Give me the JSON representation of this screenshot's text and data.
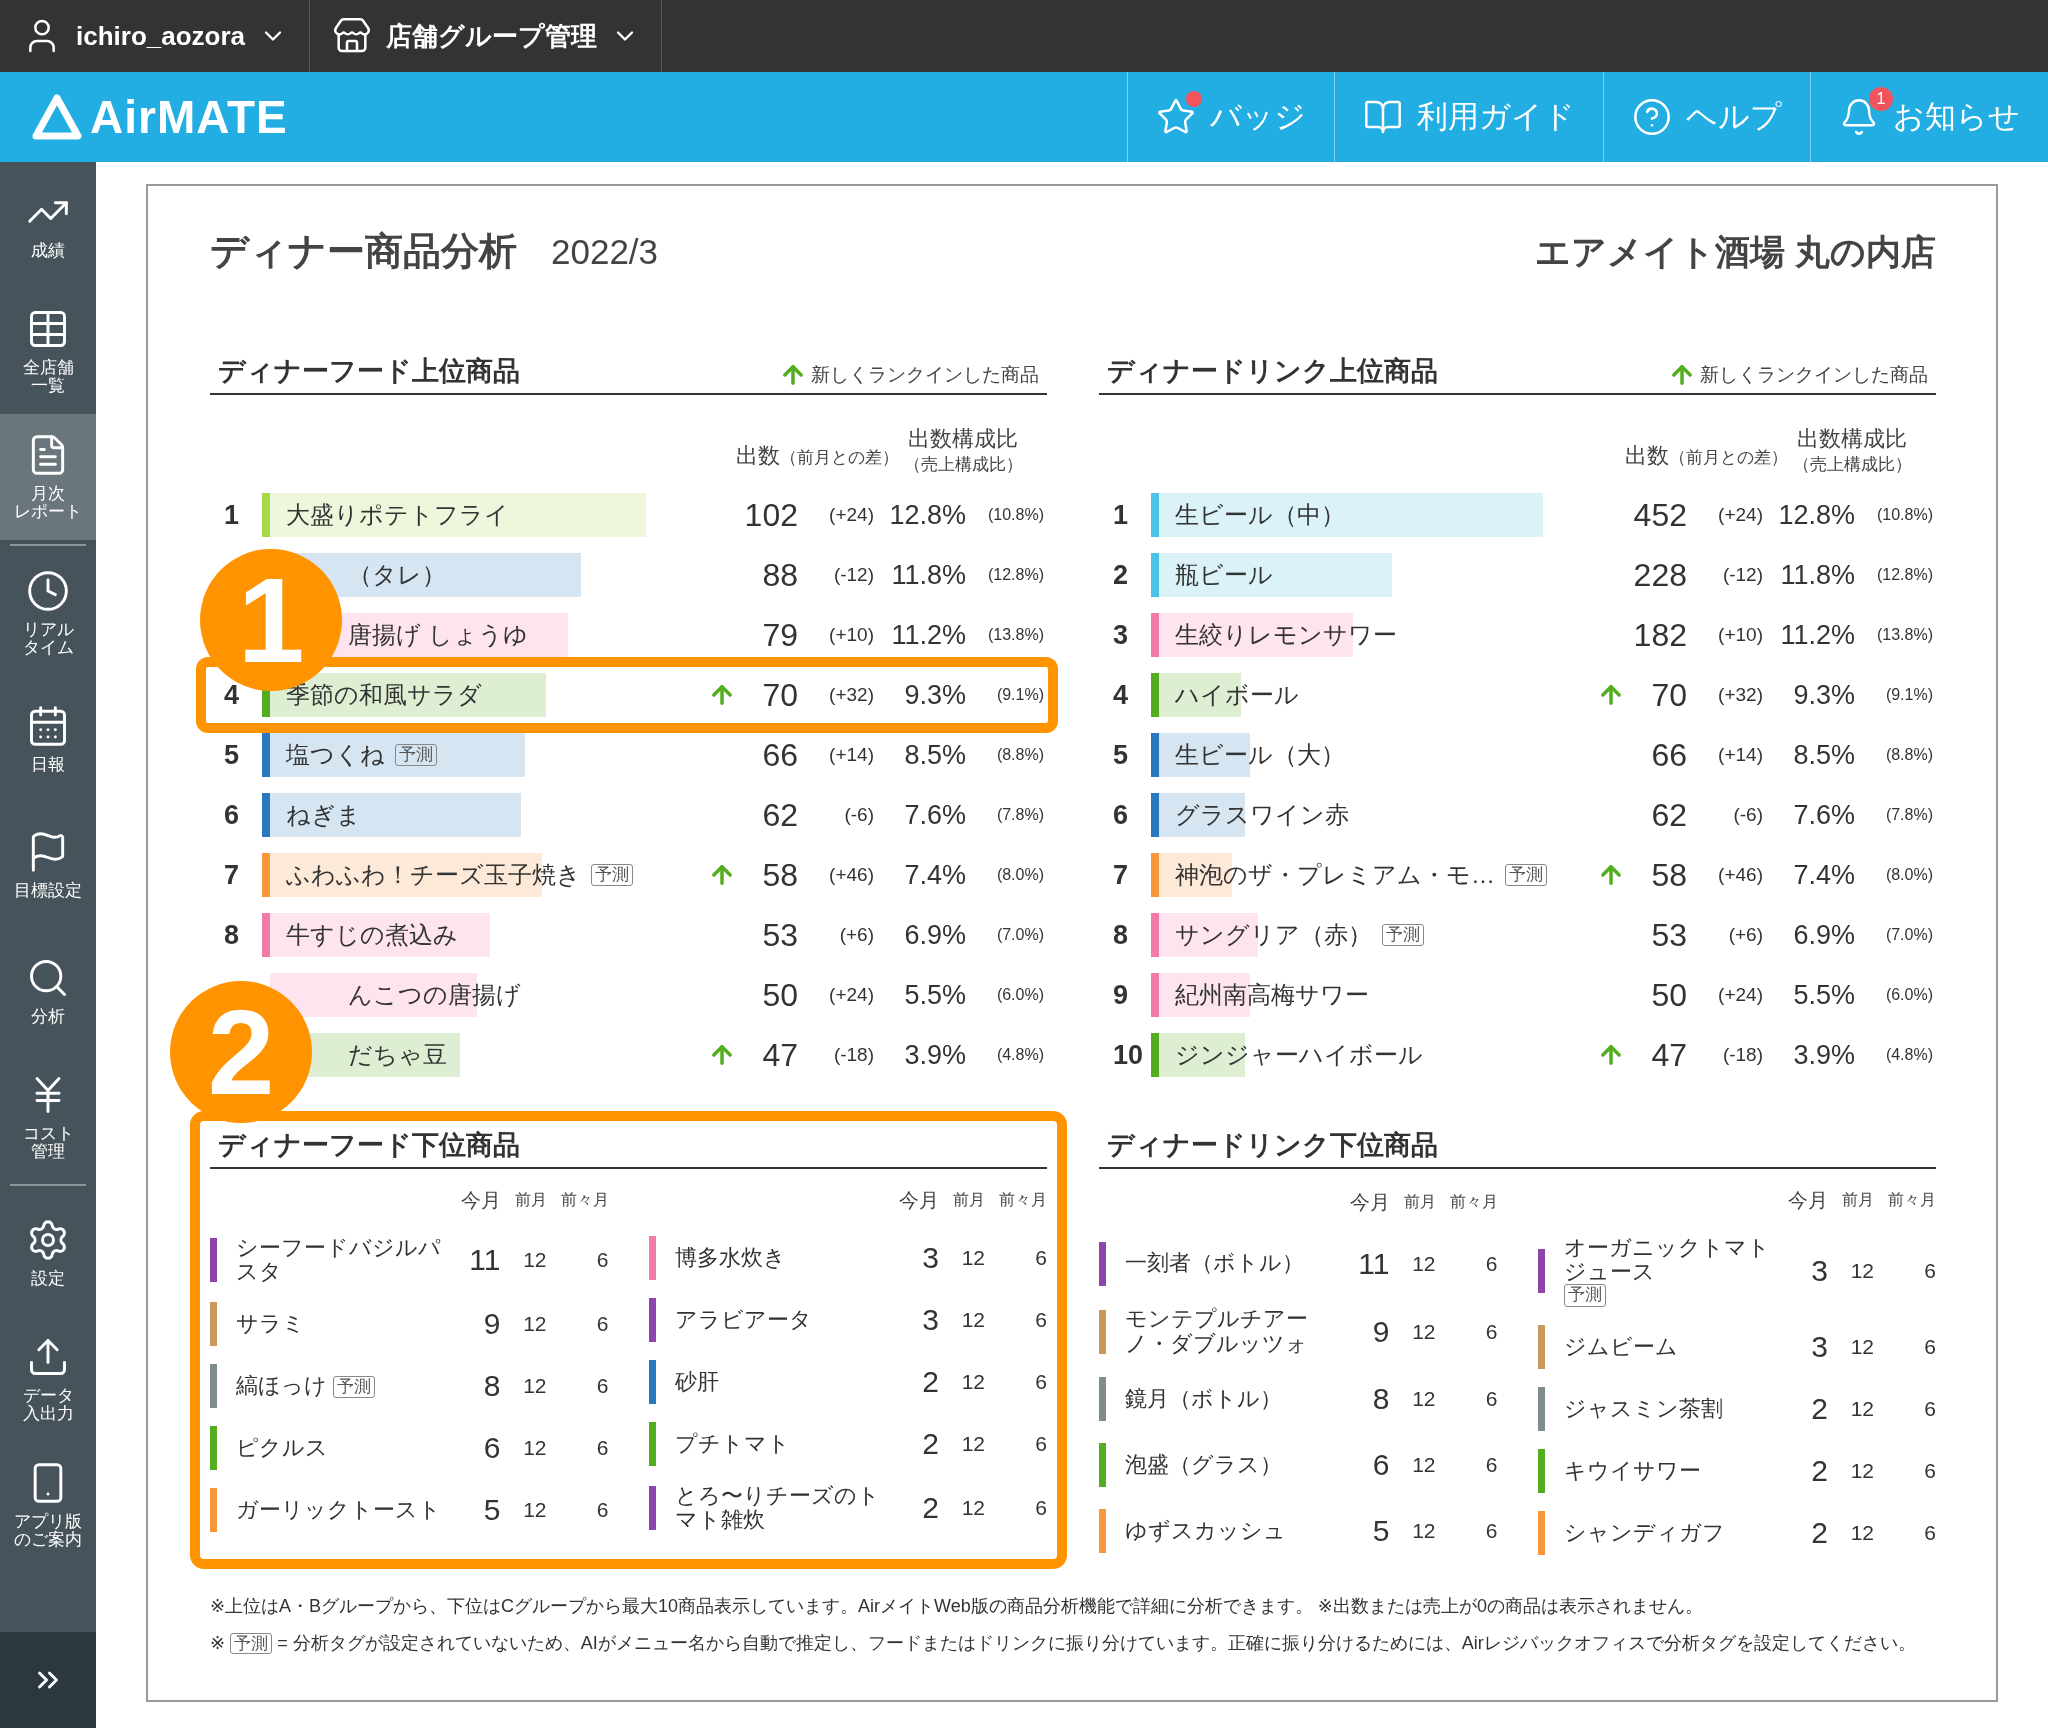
{
  "topbar": {
    "user": "ichiro_aozora",
    "group": "店舗グループ管理"
  },
  "header": {
    "logo": "AirMATE",
    "nav": [
      {
        "label": "バッジ",
        "dot": true
      },
      {
        "label": "利用ガイド",
        "dot": false
      },
      {
        "label": "ヘルプ",
        "dot": false
      },
      {
        "label": "お知らせ",
        "dot": false,
        "badge": "1"
      }
    ]
  },
  "sidebar": {
    "items": [
      {
        "lines": [
          "成績"
        ],
        "selected": false
      },
      {
        "lines": [
          "全店舗",
          "一覧"
        ],
        "selected": false
      },
      {
        "lines": [
          "月次",
          "レポート"
        ],
        "selected": true
      },
      {
        "lines": [
          "リアル",
          "タイム"
        ],
        "selected": false
      },
      {
        "lines": [
          "日報"
        ],
        "selected": false
      },
      {
        "lines": [
          "目標設定"
        ],
        "selected": false
      },
      {
        "lines": [
          "分析"
        ],
        "selected": false
      },
      {
        "lines": [
          "コスト",
          "管理"
        ],
        "selected": false
      },
      {
        "lines": [
          "設定"
        ],
        "selected": false
      },
      {
        "lines": [
          "データ",
          "入出力"
        ],
        "selected": false
      },
      {
        "lines": [
          "アプリ版",
          "のご案内"
        ],
        "selected": false
      }
    ]
  },
  "report": {
    "title": "ディナー商品分析",
    "period": "2022/3",
    "store": "エアメイト酒場 丸の内店",
    "top_sections": [
      {
        "heading": "ディナーフード上位商品",
        "legend": "新しくランクインした商品",
        "col_count": "出数",
        "col_count_sub": "（前月との差）",
        "col_ratio": "出数構成比",
        "col_ratio_sub": "（売上構成比）",
        "callout": "1",
        "rows": [
          {
            "rank": "1",
            "name": "大盛りポテトフライ",
            "color": "#a6d94a",
            "bar": {
              "color": "#eef7dc",
              "level": 0.87
            },
            "new": false,
            "covered": false,
            "highlighted": false,
            "count": "102",
            "diff": "(+24)",
            "ratio": "12.8%",
            "sales_ratio": "(10.8%)"
          },
          {
            "name": "（タレ）",
            "bar": {
              "color": "#d5e5f2",
              "level": 0.72
            },
            "new": false,
            "covered": true,
            "highlighted": false,
            "count": "88",
            "diff": "(-12)",
            "ratio": "11.8%",
            "sales_ratio": "(12.8%)"
          },
          {
            "name": "唐揚げ しょうゆ",
            "bar": {
              "color": "#fde4ee",
              "level": 0.69
            },
            "new": false,
            "covered": true,
            "highlighted": false,
            "count": "79",
            "diff": "(+10)",
            "ratio": "11.2%",
            "sales_ratio": "(13.8%)"
          },
          {
            "rank": "4",
            "name": "季節の和風サラダ",
            "color": "#52ad1f",
            "bar": {
              "color": "#ddeed2",
              "level": 0.64
            },
            "new": true,
            "covered": false,
            "highlighted": true,
            "count": "70",
            "diff": "(+32)",
            "ratio": "9.3%",
            "sales_ratio": "(9.1%)"
          },
          {
            "rank": "5",
            "name": "塩つくね",
            "tag": "予測",
            "color": "#2a78bd",
            "bar": {
              "color": "#d5e5f2",
              "level": 0.59
            },
            "new": false,
            "covered": false,
            "highlighted": false,
            "count": "66",
            "diff": "(+14)",
            "ratio": "8.5%",
            "sales_ratio": "(8.8%)"
          },
          {
            "rank": "6",
            "name": "ねぎま",
            "color": "#2a78bd",
            "bar": {
              "color": "#d5e5f2",
              "level": 0.58
            },
            "new": false,
            "covered": false,
            "highlighted": false,
            "count": "62",
            "diff": "(-6)",
            "ratio": "7.6%",
            "sales_ratio": "(7.8%)"
          },
          {
            "rank": "7",
            "name": "ふわふわ！チーズ玉子焼き",
            "tag": "予測",
            "color": "#f7963a",
            "bar": {
              "color": "#fde9d8",
              "level": 0.63
            },
            "new": true,
            "covered": false,
            "highlighted": false,
            "count": "58",
            "diff": "(+46)",
            "ratio": "7.4%",
            "sales_ratio": "(8.0%)"
          },
          {
            "rank": "8",
            "name": "牛すじの煮込み",
            "color": "#f27aa8",
            "bar": {
              "color": "#fde4ee",
              "level": 0.51
            },
            "new": false,
            "covered": false,
            "highlighted": false,
            "count": "53",
            "diff": "(+6)",
            "ratio": "6.9%",
            "sales_ratio": "(7.0%)"
          },
          {
            "name": "んこつの唐揚げ",
            "bar": {
              "color": "#fde4ee",
              "level": 0.48
            },
            "new": false,
            "covered": true,
            "highlighted": false,
            "count": "50",
            "diff": "(+24)",
            "ratio": "5.5%",
            "sales_ratio": "(6.0%)"
          },
          {
            "name": "だちゃ豆",
            "bar": {
              "color": "#ddeed2",
              "level": 0.44
            },
            "new": true,
            "covered": true,
            "highlighted": false,
            "count": "47",
            "diff": "(-18)",
            "ratio": "3.9%",
            "sales_ratio": "(4.8%)"
          }
        ]
      },
      {
        "heading": "ディナードリンク上位商品",
        "legend": "新しくランクインした商品",
        "col_count": "出数",
        "col_count_sub": "（前月との差）",
        "col_ratio": "出数構成比",
        "col_ratio_sub": "（売上構成比）",
        "rows": [
          {
            "rank": "1",
            "name": "生ビール（中）",
            "color": "#4cc3e6",
            "bar": {
              "color": "#dbf2f9",
              "level": 0.89
            },
            "new": false,
            "covered": false,
            "highlighted": false,
            "count": "452",
            "diff": "(+24)",
            "ratio": "12.8%",
            "sales_ratio": "(10.8%)"
          },
          {
            "rank": "2",
            "name": "瓶ビール",
            "color": "#4cc3e6",
            "bar": {
              "color": "#dbf2f9",
              "level": 0.54
            },
            "new": false,
            "covered": false,
            "highlighted": false,
            "count": "228",
            "diff": "(-12)",
            "ratio": "11.8%",
            "sales_ratio": "(12.8%)"
          },
          {
            "rank": "3",
            "name": "生絞りレモンサワー",
            "color": "#f27aa8",
            "bar": {
              "color": "#fde4ee",
              "level": 0.45
            },
            "new": false,
            "covered": false,
            "highlighted": false,
            "count": "182",
            "diff": "(+10)",
            "ratio": "11.2%",
            "sales_ratio": "(13.8%)"
          },
          {
            "rank": "4",
            "name": "ハイボール",
            "color": "#52ad1f",
            "bar": {
              "color": "#ddeed2",
              "level": 0.19
            },
            "new": true,
            "covered": false,
            "highlighted": false,
            "count": "70",
            "diff": "(+32)",
            "ratio": "9.3%",
            "sales_ratio": "(9.1%)"
          },
          {
            "rank": "5",
            "name": "生ビール（大）",
            "color": "#2a78bd",
            "bar": {
              "color": "#d5e5f2",
              "level": 0.21
            },
            "new": false,
            "covered": false,
            "highlighted": false,
            "count": "66",
            "diff": "(+14)",
            "ratio": "8.5%",
            "sales_ratio": "(8.8%)"
          },
          {
            "rank": "6",
            "name": "グラスワイン赤",
            "color": "#2a78bd",
            "bar": {
              "color": "#d5e5f2",
              "level": 0.2
            },
            "new": false,
            "covered": false,
            "highlighted": false,
            "count": "62",
            "diff": "(-6)",
            "ratio": "7.6%",
            "sales_ratio": "(7.8%)"
          },
          {
            "rank": "7",
            "name": "神泡のザ・プレミアム・モ…",
            "tag": "予測",
            "color": "#f7963a",
            "bar": {
              "color": "#fde9d8",
              "level": 0.17
            },
            "new": true,
            "covered": false,
            "highlighted": false,
            "count": "58",
            "diff": "(+46)",
            "ratio": "7.4%",
            "sales_ratio": "(8.0%)"
          },
          {
            "rank": "8",
            "name": "サングリア（赤）",
            "tag": "予測",
            "color": "#f27aa8",
            "bar": {
              "color": "#fde4ee",
              "level": 0.23
            },
            "new": false,
            "covered": false,
            "highlighted": false,
            "count": "53",
            "diff": "(+6)",
            "ratio": "6.9%",
            "sales_ratio": "(7.0%)"
          },
          {
            "rank": "9",
            "name": "紀州南高梅サワー",
            "color": "#f27aa8",
            "bar": {
              "color": "#fde4ee",
              "level": 0.21
            },
            "new": false,
            "covered": false,
            "highlighted": false,
            "count": "50",
            "diff": "(+24)",
            "ratio": "5.5%",
            "sales_ratio": "(6.0%)"
          },
          {
            "rank": "10",
            "name": "ジンジャーハイボール",
            "color": "#52ad1f",
            "bar": {
              "color": "#ddeed2",
              "level": 0.2
            },
            "new": true,
            "covered": false,
            "highlighted": false,
            "count": "47",
            "diff": "(-18)",
            "ratio": "3.9%",
            "sales_ratio": "(4.8%)"
          }
        ]
      }
    ],
    "bottom_sections": [
      {
        "heading": "ディナーフード下位商品",
        "highlighted": true,
        "callout": "2",
        "columns": [
          {
            "headers": [
              "今月",
              "前月",
              "前々月"
            ],
            "items": [
              {
                "name": "シーフードバジルパスタ",
                "color": "#8e44ad",
                "this_month": "11",
                "last_month": "12",
                "two_months_ago": "6"
              },
              {
                "name": "サラミ",
                "color": "#c9995a",
                "this_month": "9",
                "last_month": "12",
                "two_months_ago": "6"
              },
              {
                "name": "縞ほっけ",
                "tag": "予測",
                "color": "#7f8c8d",
                "this_month": "8",
                "last_month": "12",
                "two_months_ago": "6"
              },
              {
                "name": "ピクルス",
                "color": "#52ad1f",
                "this_month": "6",
                "last_month": "12",
                "two_months_ago": "6"
              },
              {
                "name": "ガーリックトースト",
                "color": "#f7963a",
                "this_month": "5",
                "last_month": "12",
                "two_months_ago": "6"
              }
            ]
          },
          {
            "headers": [
              "今月",
              "前月",
              "前々月"
            ],
            "items": [
              {
                "name": "博多水炊き",
                "color": "#f27aa8",
                "this_month": "3",
                "last_month": "12",
                "two_months_ago": "6"
              },
              {
                "name": "アラビアータ",
                "color": "#8e44ad",
                "this_month": "3",
                "last_month": "12",
                "two_months_ago": "6"
              },
              {
                "name": "砂肝",
                "color": "#2a78bd",
                "this_month": "2",
                "last_month": "12",
                "two_months_ago": "6"
              },
              {
                "name": "プチトマト",
                "color": "#52ad1f",
                "this_month": "2",
                "last_month": "12",
                "two_months_ago": "6"
              },
              {
                "name": "とろ〜りチーズのトマト雑炊",
                "color": "#8e44ad",
                "this_month": "2",
                "last_month": "12",
                "two_months_ago": "6"
              }
            ]
          }
        ]
      },
      {
        "heading": "ディナードリンク下位商品",
        "highlighted": false,
        "columns": [
          {
            "headers": [
              "今月",
              "前月",
              "前々月"
            ],
            "items": [
              {
                "name": "一刻者（ボトル）",
                "color": "#8e44ad",
                "this_month": "11",
                "last_month": "12",
                "two_months_ago": "6"
              },
              {
                "name": "モンテプルチアーノ・ダブルッツォ",
                "color": "#c9995a",
                "this_month": "9",
                "last_month": "12",
                "two_months_ago": "6"
              },
              {
                "name": "鏡月（ボトル）",
                "color": "#7f8c8d",
                "this_month": "8",
                "last_month": "12",
                "two_months_ago": "6"
              },
              {
                "name": "泡盛（グラス）",
                "color": "#52ad1f",
                "this_month": "6",
                "last_month": "12",
                "two_months_ago": "6"
              },
              {
                "name": "ゆずスカッシュ",
                "color": "#f7963a",
                "this_month": "5",
                "last_month": "12",
                "two_months_ago": "6"
              }
            ]
          },
          {
            "headers": [
              "今月",
              "前月",
              "前々月"
            ],
            "items": [
              {
                "name": "オーガニックトマトジュース",
                "tag": "予測",
                "color": "#8e44ad",
                "this_month": "3",
                "last_month": "12",
                "two_months_ago": "6"
              },
              {
                "name": "ジムビーム",
                "color": "#c9995a",
                "this_month": "3",
                "last_month": "12",
                "two_months_ago": "6"
              },
              {
                "name": "ジャスミン茶割",
                "color": "#7f8c8d",
                "this_month": "2",
                "last_month": "12",
                "two_months_ago": "6"
              },
              {
                "name": "キウイサワー",
                "color": "#52ad1f",
                "this_month": "2",
                "last_month": "12",
                "two_months_ago": "6"
              },
              {
                "name": "シャンディガフ",
                "color": "#f7963a",
                "this_month": "2",
                "last_month": "12",
                "two_months_ago": "6"
              }
            ]
          }
        ]
      }
    ],
    "notes": [
      {
        "text": "※上位はA・Bグループから、下位はCグループから最大10商品表示しています。AirメイトWeb版の商品分析機能で詳細に分析できます。 ※出数または売上が0の商品は表示されません。"
      },
      {
        "prefix": "※",
        "tag": "予測",
        "text": "= 分析タグが設定されていないため、AIがメニュー名から自動で推定し、フードまたはドリンクに振り分けています。正確に振り分けるためには、Airレジバックオフィスで分析タグを設定してください。"
      }
    ]
  }
}
